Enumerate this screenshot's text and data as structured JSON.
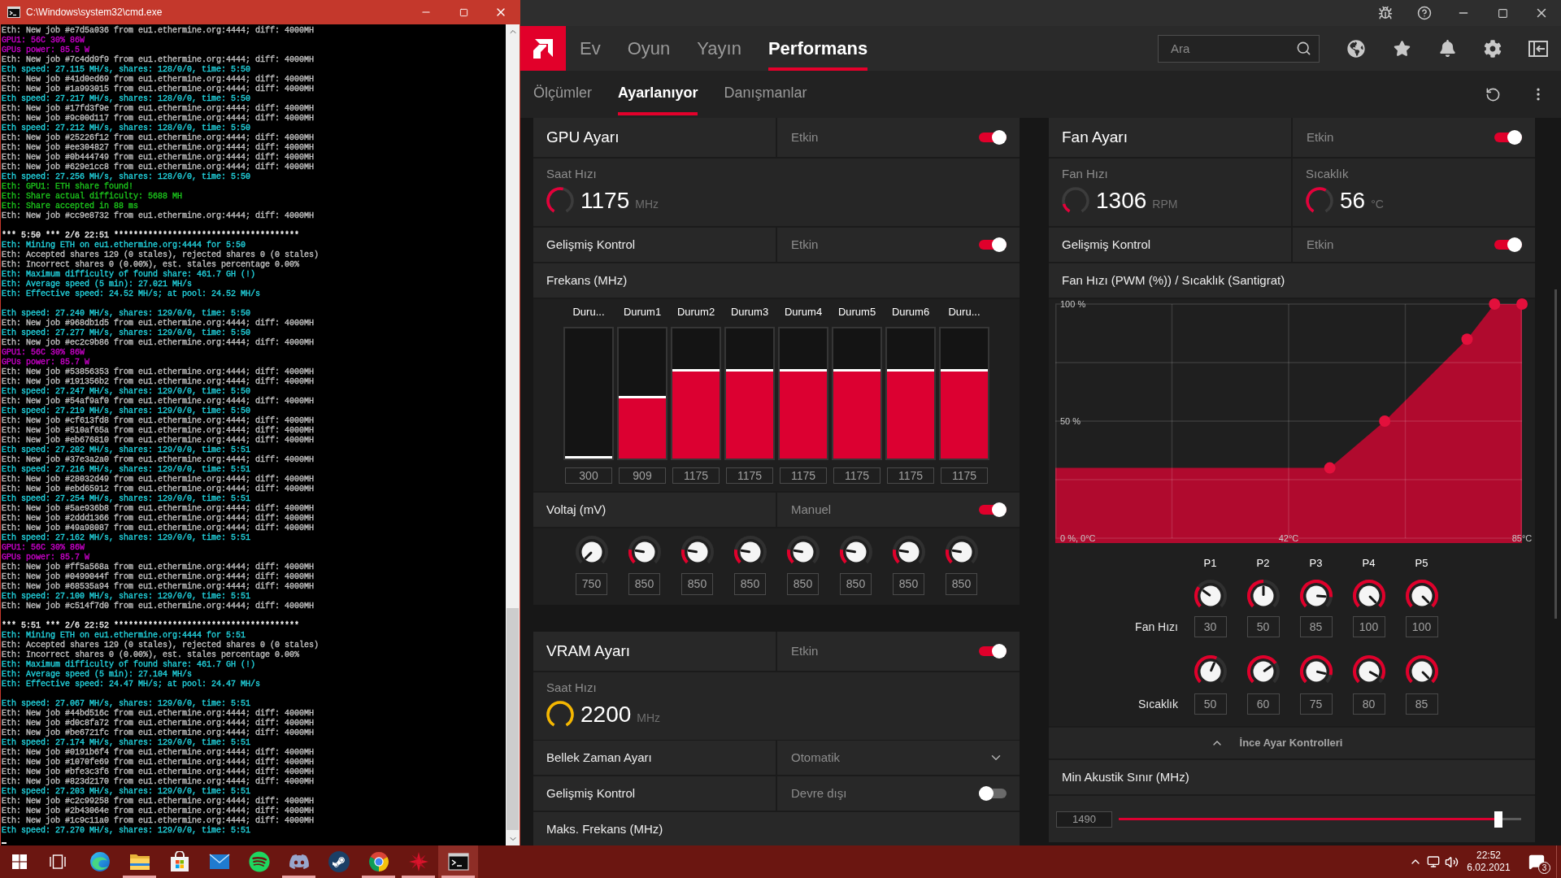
{
  "console": {
    "title": "C:\\Windows\\system32\\cmd.exe",
    "blocks": [
      [
        {
          "text": "Eth: New job #e7d5a036 from eu1.ethermine.org:4444; diff: 4000MH",
          "color": "#c0c0c0"
        },
        {
          "text": "GPU1: 56C 30% 86W",
          "color": "#cc00cc"
        },
        {
          "text": "GPUs power: 85.5 W",
          "color": "#cc00cc"
        },
        {
          "text": "Eth: New job #7c4dd9f9 from eu1.ethermine.org:4444; diff: 4000MH",
          "color": "#c0c0c0"
        },
        {
          "text": "Eth speed: 27.115 MH/s, shares: 128/0/0, time: 5:50",
          "color": "#22d3de"
        },
        {
          "text": "Eth: New job #41d0ed69 from eu1.ethermine.org:4444; diff: 4000MH",
          "color": "#c0c0c0"
        },
        {
          "text": "Eth: New job #1a993015 from eu1.ethermine.org:4444; diff: 4000MH",
          "color": "#c0c0c0"
        },
        {
          "text": "Eth speed: 27.217 MH/s, shares: 128/0/0, time: 5:50",
          "color": "#22d3de"
        },
        {
          "text": "Eth: New job #17fd3f9e from eu1.ethermine.org:4444; diff: 4000MH",
          "color": "#c0c0c0"
        },
        {
          "text": "Eth: New job #9c00d117 from eu1.ethermine.org:4444; diff: 4000MH",
          "color": "#c0c0c0"
        },
        {
          "text": "Eth speed: 27.212 MH/s, shares: 128/0/0, time: 5:50",
          "color": "#22d3de"
        },
        {
          "text": "Eth: New job #25226f12 from eu1.ethermine.org:4444; diff: 4000MH",
          "color": "#c0c0c0"
        },
        {
          "text": "Eth: New job #ee304827 from eu1.ethermine.org:4444; diff: 4000MH",
          "color": "#c0c0c0"
        },
        {
          "text": "Eth: New job #0b444749 from eu1.ethermine.org:4444; diff: 4000MH",
          "color": "#c0c0c0"
        },
        {
          "text": "Eth: New job #629e1cc8 from eu1.ethermine.org:4444; diff: 4000MH",
          "color": "#c0c0c0"
        },
        {
          "text": "Eth speed: 27.256 MH/s, shares: 128/0/0, time: 5:50",
          "color": "#22d3de"
        },
        {
          "text": "Eth: GPU1: ETH share found!",
          "color": "#1cc51c"
        },
        {
          "text": "Eth: Share actual difficulty: 5688 MH",
          "color": "#1cc51c"
        },
        {
          "text": "Eth: Share accepted in 88 ms",
          "color": "#1cc51c"
        },
        {
          "text": "Eth: New job #cc9e8732 from eu1.ethermine.org:4444; diff: 4000MH",
          "color": "#c0c0c0"
        }
      ],
      [
        {
          "text": "*** 5:50 *** 2/6 22:51 **************************************",
          "color": "#f2f2f2"
        },
        {
          "text": "Eth: Mining ETH on eu1.ethermine.org:4444 for 5:50",
          "color": "#22d3de"
        },
        {
          "text": "Eth: Accepted shares 129 (0 stales), rejected shares 0 (0 stales)",
          "color": "#c0c0c0"
        },
        {
          "text": "Eth: Incorrect shares 0 (0.00%), est. stales percentage 0.00%",
          "color": "#c0c0c0"
        },
        {
          "text": "Eth: Maximum difficulty of found share: 461.7 GH (!)",
          "color": "#22d3de"
        },
        {
          "text": "Eth: Average speed (5 min): 27.021 MH/s",
          "color": "#22d3de"
        },
        {
          "text": "Eth: Effective speed: 24.52 MH/s; at pool: 24.52 MH/s",
          "color": "#22d3de"
        }
      ],
      [
        {
          "text": "Eth speed: 27.240 MH/s, shares: 129/0/0, time: 5:50",
          "color": "#22d3de"
        },
        {
          "text": "Eth: New job #968db1d5 from eu1.ethermine.org:4444; diff: 4000MH",
          "color": "#c0c0c0"
        },
        {
          "text": "Eth speed: 27.277 MH/s, shares: 129/0/0, time: 5:50",
          "color": "#22d3de"
        },
        {
          "text": "Eth: New job #ec2c9b86 from eu1.ethermine.org:4444; diff: 4000MH",
          "color": "#c0c0c0"
        },
        {
          "text": "GPU1: 56C 30% 86W",
          "color": "#cc00cc"
        },
        {
          "text": "GPUs power: 85.7 W",
          "color": "#cc00cc"
        },
        {
          "text": "Eth: New job #53856353 from eu1.ethermine.org:4444; diff: 4000MH",
          "color": "#c0c0c0"
        },
        {
          "text": "Eth: New job #191356b2 from eu1.ethermine.org:4444; diff: 4000MH",
          "color": "#c0c0c0"
        },
        {
          "text": "Eth speed: 27.247 MH/s, shares: 129/0/0, time: 5:50",
          "color": "#22d3de"
        },
        {
          "text": "Eth: New job #54af9af0 from eu1.ethermine.org:4444; diff: 4000MH",
          "color": "#c0c0c0"
        },
        {
          "text": "Eth speed: 27.219 MH/s, shares: 129/0/0, time: 5:50",
          "color": "#22d3de"
        },
        {
          "text": "Eth: New job #cf613fd8 from eu1.ethermine.org:4444; diff: 4000MH",
          "color": "#c0c0c0"
        },
        {
          "text": "Eth: New job #510af65a from eu1.ethermine.org:4444; diff: 4000MH",
          "color": "#c0c0c0"
        },
        {
          "text": "Eth: New job #eb676810 from eu1.ethermine.org:4444; diff: 4000MH",
          "color": "#c0c0c0"
        },
        {
          "text": "Eth speed: 27.202 MH/s, shares: 129/0/0, time: 5:51",
          "color": "#22d3de"
        },
        {
          "text": "Eth: New job #37e3a2a0 from eu1.ethermine.org:4444; diff: 4000MH",
          "color": "#c0c0c0"
        },
        {
          "text": "Eth speed: 27.216 MH/s, shares: 129/0/0, time: 5:51",
          "color": "#22d3de"
        },
        {
          "text": "Eth: New job #28032d49 from eu1.ethermine.org:4444; diff: 4000MH",
          "color": "#c0c0c0"
        },
        {
          "text": "Eth: New job #ebd65912 from eu1.ethermine.org:4444; diff: 4000MH",
          "color": "#c0c0c0"
        },
        {
          "text": "Eth speed: 27.254 MH/s, shares: 129/0/0, time: 5:51",
          "color": "#22d3de"
        },
        {
          "text": "Eth: New job #5ae936b8 from eu1.ethermine.org:4444; diff: 4000MH",
          "color": "#c0c0c0"
        },
        {
          "text": "Eth: New job #2ddd1366 from eu1.ethermine.org:4444; diff: 4000MH",
          "color": "#c0c0c0"
        },
        {
          "text": "Eth: New job #49a98087 from eu1.ethermine.org:4444; diff: 4000MH",
          "color": "#c0c0c0"
        },
        {
          "text": "Eth speed: 27.162 MH/s, shares: 129/0/0, time: 5:51",
          "color": "#22d3de"
        },
        {
          "text": "GPU1: 56C 30% 86W",
          "color": "#cc00cc"
        },
        {
          "text": "GPUs power: 85.7 W",
          "color": "#cc00cc"
        },
        {
          "text": "Eth: New job #ff5a568a from eu1.ethermine.org:4444; diff: 4000MH",
          "color": "#c0c0c0"
        },
        {
          "text": "Eth: New job #0499044f from eu1.ethermine.org:4444; diff: 4000MH",
          "color": "#c0c0c0"
        },
        {
          "text": "Eth: New job #68535a94 from eu1.ethermine.org:4444; diff: 4000MH",
          "color": "#c0c0c0"
        },
        {
          "text": "Eth speed: 27.100 MH/s, shares: 129/0/0, time: 5:51",
          "color": "#22d3de"
        },
        {
          "text": "Eth: New job #c514f7d0 from eu1.ethermine.org:4444; diff: 4000MH",
          "color": "#c0c0c0"
        }
      ],
      [
        {
          "text": "*** 5:51 *** 2/6 22:52 **************************************",
          "color": "#f2f2f2"
        },
        {
          "text": "Eth: Mining ETH on eu1.ethermine.org:4444 for 5:51",
          "color": "#22d3de"
        },
        {
          "text": "Eth: Accepted shares 129 (0 stales), rejected shares 0 (0 stales)",
          "color": "#c0c0c0"
        },
        {
          "text": "Eth: Incorrect shares 0 (0.00%), est. stales percentage 0.00%",
          "color": "#c0c0c0"
        },
        {
          "text": "Eth: Maximum difficulty of found share: 461.7 GH (!)",
          "color": "#22d3de"
        },
        {
          "text": "Eth: Average speed (5 min): 27.104 MH/s",
          "color": "#22d3de"
        },
        {
          "text": "Eth: Effective speed: 24.47 MH/s; at pool: 24.47 MH/s",
          "color": "#22d3de"
        }
      ],
      [
        {
          "text": "Eth speed: 27.067 MH/s, shares: 129/0/0, time: 5:51",
          "color": "#22d3de"
        },
        {
          "text": "Eth: New job #44bd516c from eu1.ethermine.org:4444; diff: 4000MH",
          "color": "#c0c0c0"
        },
        {
          "text": "Eth: New job #d0c8fa72 from eu1.ethermine.org:4444; diff: 4000MH",
          "color": "#c0c0c0"
        },
        {
          "text": "Eth: New job #be6721fc from eu1.ethermine.org:4444; diff: 4000MH",
          "color": "#c0c0c0"
        },
        {
          "text": "Eth speed: 27.174 MH/s, shares: 129/0/0, time: 5:51",
          "color": "#22d3de"
        },
        {
          "text": "Eth: New job #0191b6f4 from eu1.ethermine.org:4444; diff: 4000MH",
          "color": "#c0c0c0"
        },
        {
          "text": "Eth: New job #1070fe69 from eu1.ethermine.org:4444; diff: 4000MH",
          "color": "#c0c0c0"
        },
        {
          "text": "Eth: New job #bfe3c3f6 from eu1.ethermine.org:4444; diff: 4000MH",
          "color": "#c0c0c0"
        },
        {
          "text": "Eth: New job #823d2170 from eu1.ethermine.org:4444; diff: 4000MH",
          "color": "#c0c0c0"
        },
        {
          "text": "Eth speed: 27.203 MH/s, shares: 129/0/0, time: 5:51",
          "color": "#22d3de"
        },
        {
          "text": "Eth: New job #c2c99258 from eu1.ethermine.org:4444; diff: 4000MH",
          "color": "#c0c0c0"
        },
        {
          "text": "Eth: New job #2b43064e from eu1.ethermine.org:4444; diff: 4000MH",
          "color": "#c0c0c0"
        },
        {
          "text": "Eth: New job #1c9c11a0 from eu1.ethermine.org:4444; diff: 4000MH",
          "color": "#c0c0c0"
        },
        {
          "text": "Eth speed: 27.270 MH/s, shares: 129/0/0, time: 5:51",
          "color": "#22d3de"
        }
      ]
    ]
  },
  "app": {
    "nav": [
      {
        "label": "Ev",
        "selected": false
      },
      {
        "label": "Oyun",
        "selected": false
      },
      {
        "label": "Yayın",
        "selected": false
      },
      {
        "label": "Performans",
        "selected": true
      }
    ],
    "search": {
      "placeholder": "Ara"
    },
    "subtabs": [
      {
        "label": "Ölçümler",
        "selected": false
      },
      {
        "label": "Ayarlanıyor",
        "selected": true
      },
      {
        "label": "Danışmanlar",
        "selected": false
      }
    ],
    "gpu": {
      "title": "GPU Ayarı",
      "status": "Etkin",
      "on": true,
      "clock": {
        "label": "Saat Hızı",
        "value": "1175",
        "unit": "MHz",
        "color": "#e4003a"
      },
      "advanced": {
        "label": "Gelişmiş Kontrol",
        "status": "Etkin",
        "on": true
      },
      "frequency": {
        "title": "Frekans (MHz)",
        "states": [
          {
            "label": "Duru...",
            "value": "300",
            "level": 0
          },
          {
            "label": "Durum1",
            "value": "909",
            "level": 0.48
          },
          {
            "label": "Durum2",
            "value": "1175",
            "level": 0.69
          },
          {
            "label": "Durum3",
            "value": "1175",
            "level": 0.69
          },
          {
            "label": "Durum4",
            "value": "1175",
            "level": 0.69
          },
          {
            "label": "Durum5",
            "value": "1175",
            "level": 0.69
          },
          {
            "label": "Durum6",
            "value": "1175",
            "level": 0.69
          },
          {
            "label": "Duru...",
            "value": "1175",
            "level": 0.69
          }
        ]
      },
      "voltage": {
        "title": "Voltaj (mV)",
        "status": "Manuel",
        "on": true,
        "knobs": [
          "750",
          "850",
          "850",
          "850",
          "850",
          "850",
          "850",
          "850"
        ]
      }
    },
    "vram": {
      "title": "VRAM Ayarı",
      "status": "Etkin",
      "on": true,
      "clock": {
        "label": "Saat Hızı",
        "value": "2200",
        "unit": "MHz",
        "color": "#f5b700"
      },
      "rows": [
        {
          "kind": "dropdown",
          "label": "Bellek Zaman Ayarı",
          "value": "Otomatik"
        },
        {
          "kind": "toggle",
          "label": "Gelişmiş Kontrol",
          "status": "Devre dışı",
          "on": false
        },
        {
          "kind": "heading",
          "label": "Maks. Frekans (MHz)"
        }
      ]
    },
    "fan": {
      "title": "Fan Ayarı",
      "status": "Etkin",
      "on": true,
      "speed": {
        "label": "Fan Hızı",
        "value": "1306",
        "unit": "RPM",
        "color": "#e4003a"
      },
      "temperature": {
        "label": "Sıcaklık",
        "value": "56",
        "unit": "°C",
        "color": "#e4003a"
      },
      "advanced": {
        "label": "Gelişmiş Kontrol",
        "status": "Etkin",
        "on": true
      },
      "curve": {
        "chart_data": {
          "type": "area",
          "title": "Fan Hızı (PWM (%)) / Sıcaklık (Santigrat)",
          "x": [
            0,
            50,
            60,
            75,
            80,
            85
          ],
          "series": [
            {
              "color": "#b00a2e",
              "values": [
                30,
                30,
                50,
                85,
                100,
                100
              ]
            }
          ],
          "xlim": [
            0,
            85
          ],
          "ylim": [
            0,
            100
          ],
          "xticks": [
            {
              "value": 42.5,
              "label": "42°C"
            },
            {
              "value": 85,
              "label": "85°C"
            }
          ],
          "yticks": [
            {
              "value": 0,
              "label": "0 %, 0°C"
            },
            {
              "value": 50,
              "label": "50 %"
            },
            {
              "value": 100,
              "label": "100 %"
            }
          ]
        }
      },
      "points": [
        "P1",
        "P2",
        "P3",
        "P4",
        "P5"
      ],
      "speed_row": {
        "label": "Fan Hızı",
        "knobs": [
          "30",
          "50",
          "85",
          "100",
          "100"
        ]
      },
      "temperature_row": {
        "label": "Sıcaklık",
        "knobs": [
          "50",
          "60",
          "75",
          "80",
          "85"
        ]
      },
      "fine_tune": {
        "label": "İnce Ayar Kontrolleri",
        "expanded": true
      },
      "acoustic": {
        "title": "Min Akustik Sınır (MHz)",
        "value": "1490",
        "level": 0.944
      }
    }
  },
  "taskbar": {
    "apps": [
      {
        "kind": "swirl",
        "running": false,
        "active": false
      },
      {
        "kind": "folder",
        "running": true,
        "active": false
      },
      {
        "kind": "bag",
        "running": false,
        "active": false
      },
      {
        "kind": "envelope",
        "running": false,
        "active": false
      },
      {
        "kind": "waves",
        "running": false,
        "active": false
      },
      {
        "kind": "controller",
        "running": true,
        "active": false
      },
      {
        "kind": "piston",
        "running": false,
        "active": false
      },
      {
        "kind": "segments",
        "running": true,
        "active": false
      },
      {
        "kind": "starburst",
        "running": true,
        "active": false
      },
      {
        "kind": "console",
        "running": true,
        "active": true
      }
    ],
    "tray": {
      "time": "22:52",
      "date": "6.02.2021",
      "notifications": "3"
    }
  }
}
